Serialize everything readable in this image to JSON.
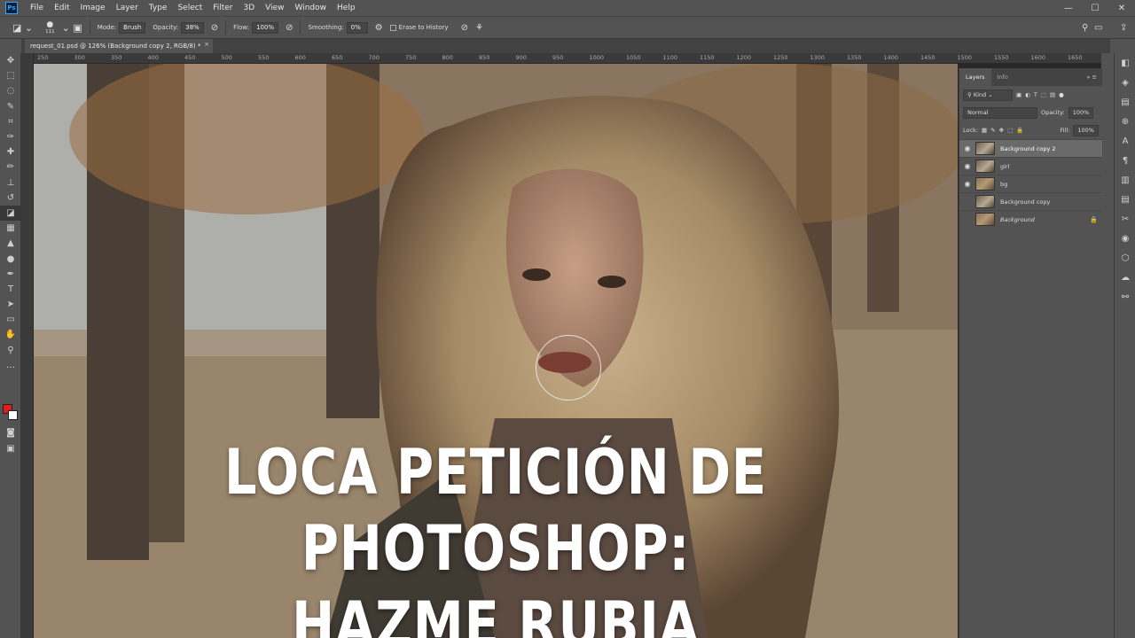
{
  "app": {
    "logo": "Ps"
  },
  "menu": [
    "File",
    "Edit",
    "Image",
    "Layer",
    "Type",
    "Select",
    "Filter",
    "3D",
    "View",
    "Window",
    "Help"
  ],
  "window_controls": {
    "minimize": "—",
    "maximize": "☐",
    "close": "✕"
  },
  "options_bar": {
    "brush_size": "111",
    "mode_label": "Mode:",
    "mode_value": "Brush",
    "opacity_label": "Opacity:",
    "opacity_value": "38%",
    "flow_label": "Flow:",
    "flow_value": "100%",
    "smoothing_label": "Smoothing:",
    "smoothing_value": "0%",
    "erase_history_label": "Erase to History"
  },
  "document_tab": {
    "title": "request_01.psd @ 126% (Background copy 2, RGB/8) *",
    "close": "×"
  },
  "ruler": {
    "ticks": [
      "250",
      "300",
      "350",
      "400",
      "450",
      "500",
      "550",
      "600",
      "650",
      "700",
      "750",
      "800",
      "850",
      "900",
      "950",
      "1000",
      "1050",
      "1100",
      "1150",
      "1200",
      "1250",
      "1300",
      "1350",
      "1400",
      "1450",
      "1500",
      "1550",
      "1600",
      "1650"
    ]
  },
  "tools": [
    {
      "name": "move-tool",
      "glyph": "✥"
    },
    {
      "name": "marquee-tool",
      "glyph": "⬚"
    },
    {
      "name": "lasso-tool",
      "glyph": "◌"
    },
    {
      "name": "quick-select-tool",
      "glyph": "✎"
    },
    {
      "name": "crop-tool",
      "glyph": "⌗"
    },
    {
      "name": "eyedropper-tool",
      "glyph": "✑"
    },
    {
      "name": "healing-tool",
      "glyph": "✚"
    },
    {
      "name": "brush-tool",
      "glyph": "✏"
    },
    {
      "name": "clone-stamp-tool",
      "glyph": "⊥"
    },
    {
      "name": "history-brush-tool",
      "glyph": "↺"
    },
    {
      "name": "eraser-tool",
      "glyph": "◪",
      "active": true
    },
    {
      "name": "gradient-tool",
      "glyph": "▦"
    },
    {
      "name": "blur-tool",
      "glyph": "▲"
    },
    {
      "name": "dodge-tool",
      "glyph": "●"
    },
    {
      "name": "pen-tool",
      "glyph": "✒"
    },
    {
      "name": "type-tool",
      "glyph": "T"
    },
    {
      "name": "path-select-tool",
      "glyph": "➤"
    },
    {
      "name": "rectangle-tool",
      "glyph": "▭"
    },
    {
      "name": "hand-tool",
      "glyph": "✋"
    },
    {
      "name": "zoom-tool",
      "glyph": "⚲"
    },
    {
      "name": "more-tools",
      "glyph": "…"
    }
  ],
  "canvas": {
    "headline_line1": "LOCA PETICIÓN DE PHOTOSHOP:",
    "headline_line2": "HAZME RUBIA"
  },
  "layers_panel": {
    "tabs": [
      "Layers",
      "Info"
    ],
    "filter_label": "Kind",
    "blend_mode": "Normal",
    "opacity_label": "Opacity:",
    "opacity_value": "100%",
    "lock_label": "Lock:",
    "fill_label": "Fill:",
    "fill_value": "100%",
    "layers": [
      {
        "name": "Background copy 2",
        "visible": true,
        "selected": true
      },
      {
        "name": "girl",
        "visible": true
      },
      {
        "name": "bg",
        "visible": true
      },
      {
        "name": "Background copy",
        "visible": false
      },
      {
        "name": "Background",
        "visible": false,
        "locked": true,
        "italic": true
      }
    ]
  },
  "colors": {
    "foreground": "#e21b1b",
    "background": "#ffffff",
    "ui": "#535353"
  }
}
